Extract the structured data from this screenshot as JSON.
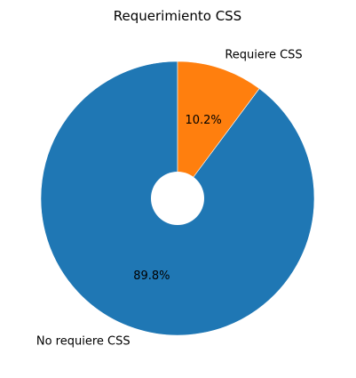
{
  "chart_data": {
    "type": "pie",
    "title": "Requerimiento CSS",
    "slices": [
      {
        "label": "No requiere CSS",
        "value": 89.8,
        "percent_label": "89.8%",
        "color": "#1f77b4"
      },
      {
        "label": "Requiere CSS",
        "value": 10.2,
        "percent_label": "10.2%",
        "color": "#ff7f0e"
      }
    ],
    "start_angle_deg": 90,
    "direction": "counterclockwise",
    "donut_hole": true,
    "legend": "none"
  }
}
